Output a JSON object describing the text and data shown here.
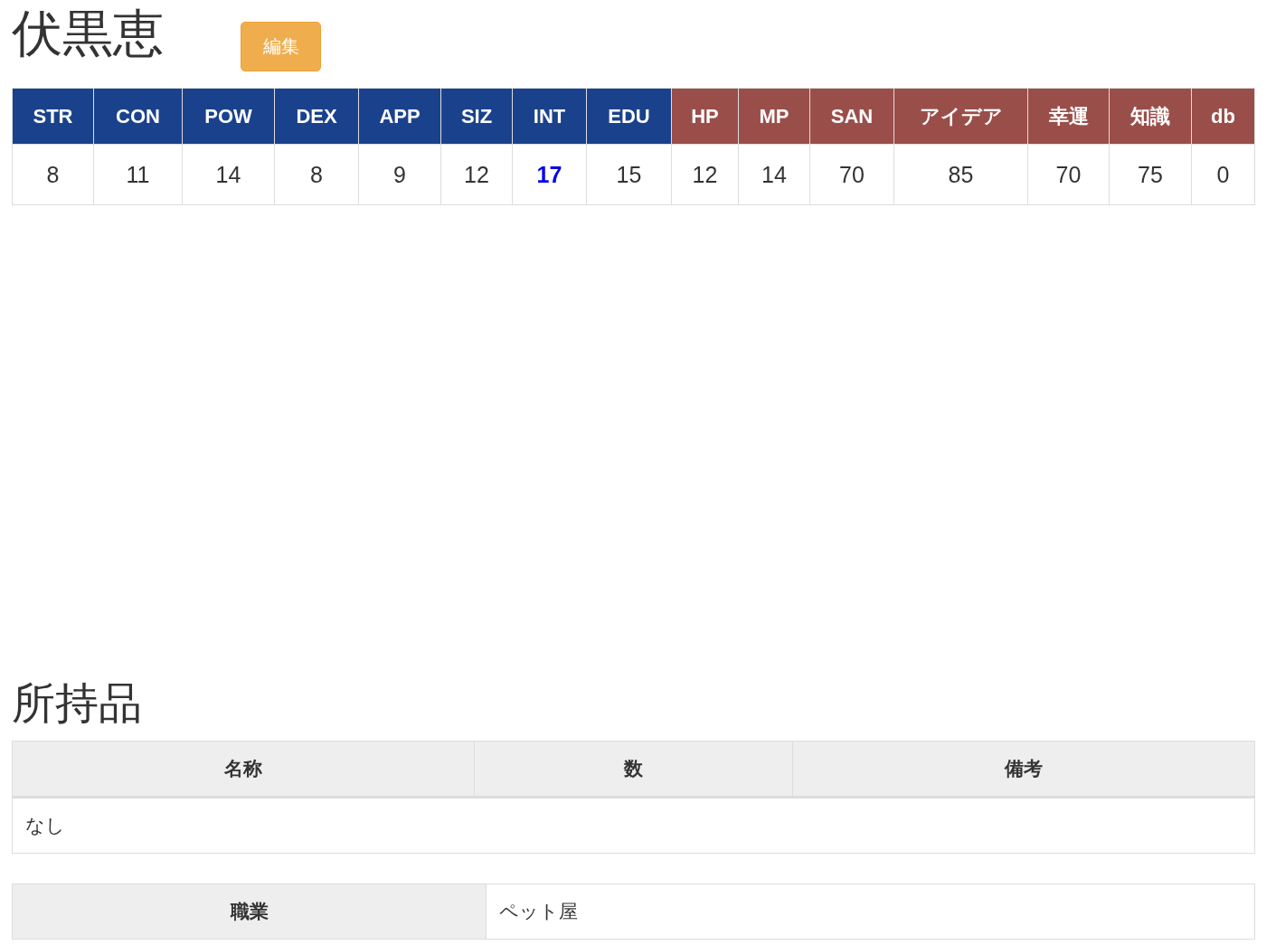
{
  "character": {
    "name": "伏黒恵",
    "edit_button": "編集"
  },
  "stats": [
    {
      "kind": "ability",
      "label": "STR",
      "value": "8",
      "highlight": false
    },
    {
      "kind": "ability",
      "label": "CON",
      "value": "11",
      "highlight": false
    },
    {
      "kind": "ability",
      "label": "POW",
      "value": "14",
      "highlight": false
    },
    {
      "kind": "ability",
      "label": "DEX",
      "value": "8",
      "highlight": false
    },
    {
      "kind": "ability",
      "label": "APP",
      "value": "9",
      "highlight": false
    },
    {
      "kind": "ability",
      "label": "SIZ",
      "value": "12",
      "highlight": false
    },
    {
      "kind": "ability",
      "label": "INT",
      "value": "17",
      "highlight": true
    },
    {
      "kind": "ability",
      "label": "EDU",
      "value": "15",
      "highlight": false
    },
    {
      "kind": "derived",
      "label": "HP",
      "value": "12",
      "highlight": false
    },
    {
      "kind": "derived",
      "label": "MP",
      "value": "14",
      "highlight": false
    },
    {
      "kind": "derived",
      "label": "SAN",
      "value": "70",
      "highlight": false
    },
    {
      "kind": "derived",
      "label": "アイデア",
      "value": "85",
      "highlight": false
    },
    {
      "kind": "derived",
      "label": "幸運",
      "value": "70",
      "highlight": false
    },
    {
      "kind": "derived",
      "label": "知識",
      "value": "75",
      "highlight": false
    },
    {
      "kind": "derived",
      "label": "db",
      "value": "0",
      "highlight": false
    }
  ],
  "inventory": {
    "title": "所持品",
    "columns": [
      "名称",
      "数",
      "備考"
    ],
    "empty_text": "なし"
  },
  "profile": [
    {
      "label": "職業",
      "value": "ペット屋"
    }
  ]
}
